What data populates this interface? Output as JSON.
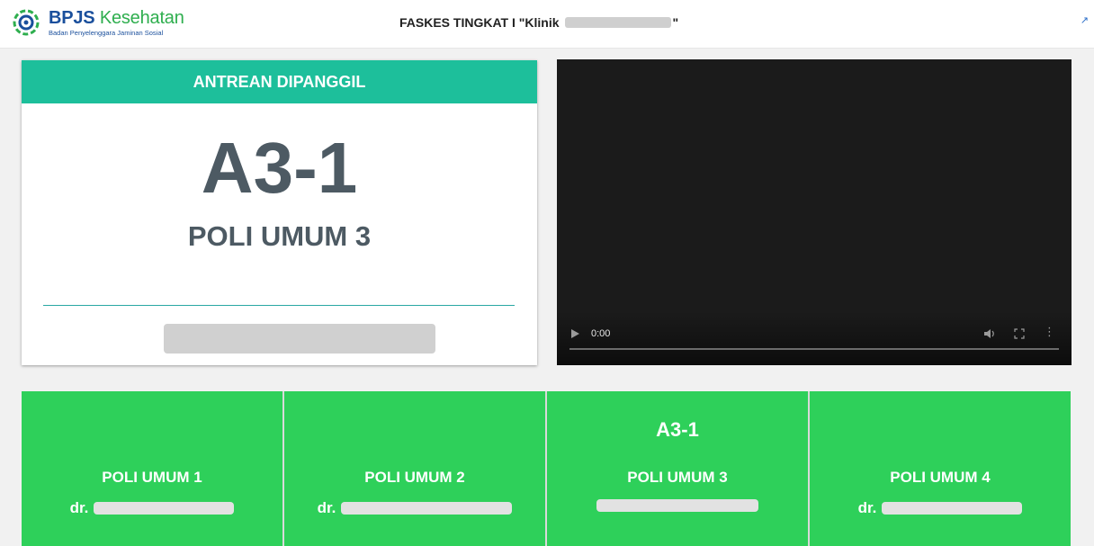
{
  "header": {
    "logo_part1": "BPJS",
    "logo_part2": "Kesehatan",
    "logo_subtitle": "Badan Penyelenggara Jaminan Sosial",
    "title_prefix": "FASKES TINGKAT I \"Klinik",
    "title_suffix": "\""
  },
  "called": {
    "heading": "ANTREAN DIPANGGIL",
    "number": "A3-1",
    "poli": "POLI UMUM 3"
  },
  "video": {
    "time": "0:00"
  },
  "tiles": [
    {
      "number": "",
      "name": "POLI UMUM 1",
      "doctor_prefix": "dr."
    },
    {
      "number": "",
      "name": "POLI UMUM 2",
      "doctor_prefix": "dr."
    },
    {
      "number": "A3-1",
      "name": "POLI UMUM 3",
      "doctor_prefix": ""
    },
    {
      "number": "",
      "name": "POLI UMUM 4",
      "doctor_prefix": "dr."
    }
  ],
  "colors": {
    "accent_teal": "#1dbf9b",
    "tile_green": "#2ed05a",
    "text_dark": "#4d5a63",
    "brand_blue": "#1a4f9c",
    "brand_green": "#2eae4e"
  },
  "icons": {
    "logo": "bpjs-logo-icon",
    "expand": "expand-icon",
    "play": "play-icon",
    "volume": "volume-icon",
    "fullscreen": "fullscreen-icon",
    "more": "more-vertical-icon"
  }
}
